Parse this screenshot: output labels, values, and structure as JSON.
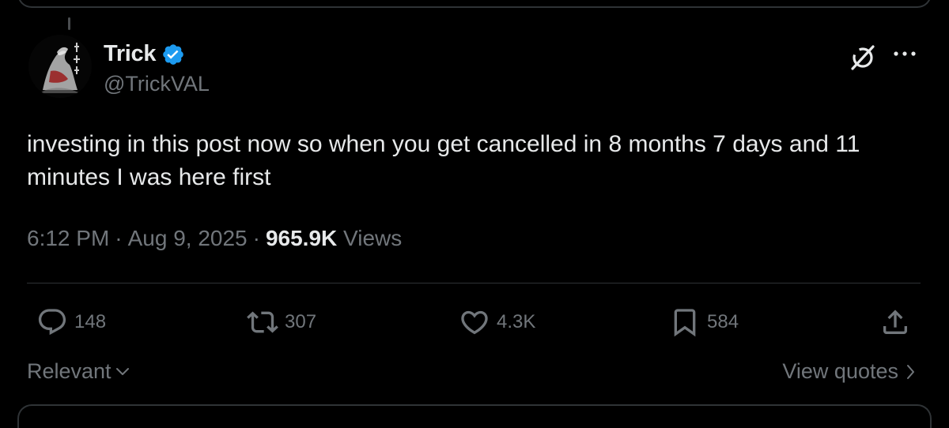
{
  "post": {
    "author": {
      "display_name": "Trick",
      "handle": "@TrickVAL",
      "verified": true,
      "avatar": "ink-wash-samurai-avatar"
    },
    "text": "investing in this post now so when you get cancelled in 8 months 7 days and 11 minutes I was here first",
    "time": "6:12 PM",
    "date": "Aug 9, 2025",
    "separator": "·",
    "views_count": "965.9K",
    "views_label": "Views"
  },
  "header_icons": {
    "grok": "grok-icon",
    "more": "more-icon"
  },
  "actions": {
    "replies": {
      "icon": "reply-icon",
      "count": "148"
    },
    "reposts": {
      "icon": "repost-icon",
      "count": "307"
    },
    "likes": {
      "icon": "heart-icon",
      "count": "4.3K"
    },
    "bookmarks": {
      "icon": "bookmark-icon",
      "count": "584"
    },
    "share": {
      "icon": "share-icon"
    }
  },
  "footer": {
    "sort_label": "Relevant",
    "view_quotes_label": "View quotes"
  },
  "colors": {
    "background": "#000000",
    "text_primary": "#e7e9ea",
    "text_secondary": "#71767b",
    "divider": "#2f3336",
    "verified_badge": "#1d9bf0"
  }
}
